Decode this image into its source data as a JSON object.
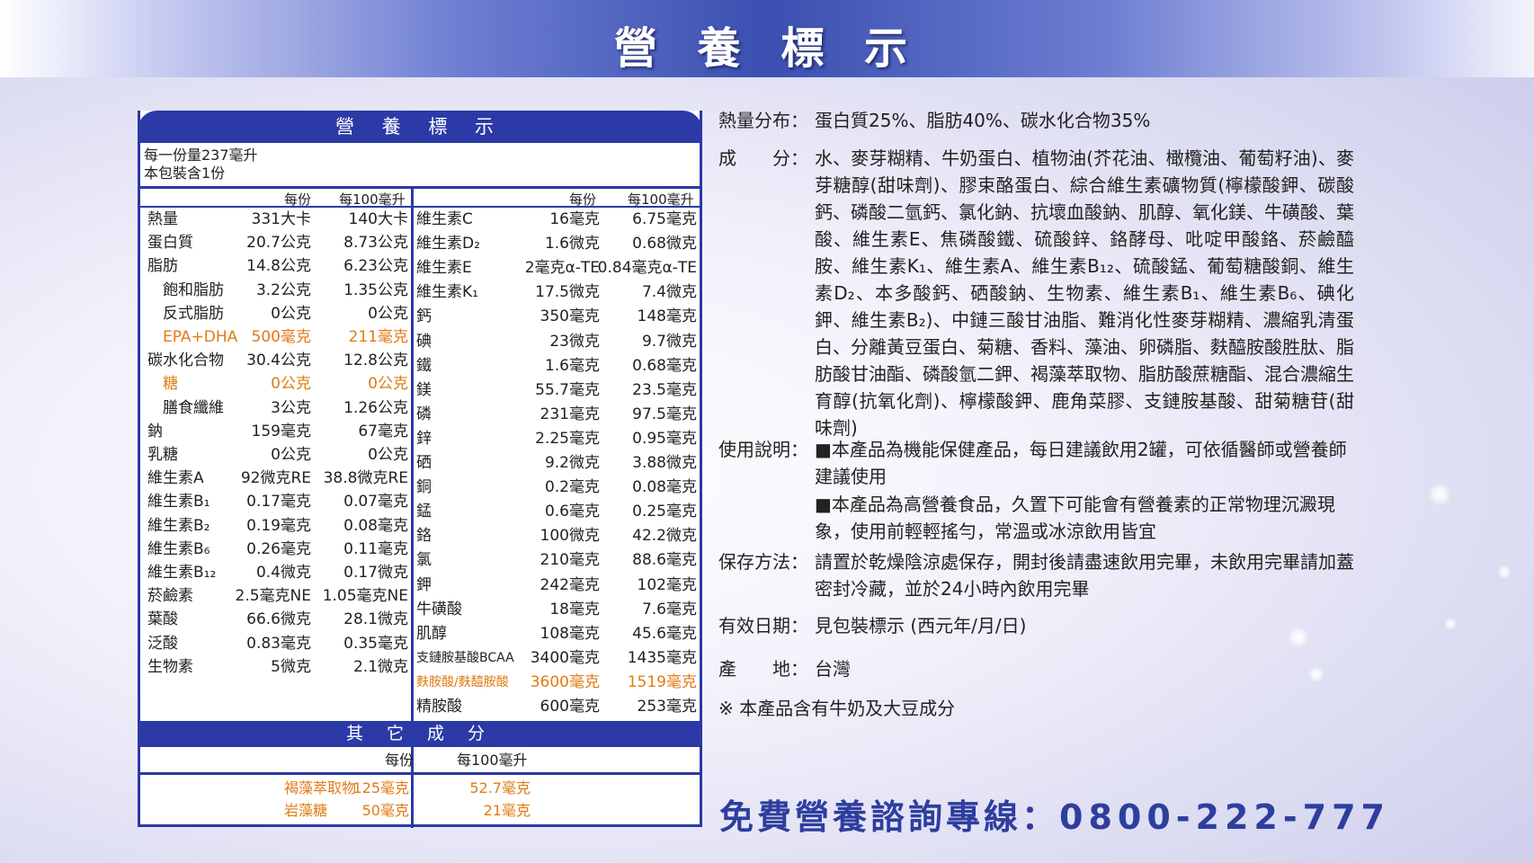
{
  "banner": {
    "title": "營 養 標 示"
  },
  "label": {
    "header": "營 養 標 示",
    "serving_size": "每一份量237毫升",
    "servings": "本包裝含1份",
    "col_per_serving": "每份",
    "col_per_100": "每100毫升",
    "left_rows": [
      {
        "name": "熱量",
        "a": "331大卡",
        "b": "140大卡"
      },
      {
        "name": "蛋白質",
        "a": "20.7公克",
        "b": "8.73公克"
      },
      {
        "name": "脂肪",
        "a": "14.8公克",
        "b": "6.23公克"
      },
      {
        "name": "飽和脂肪",
        "a": "3.2公克",
        "b": "1.35公克"
      },
      {
        "name": "反式脂肪",
        "a": "0公克",
        "b": "0公克"
      },
      {
        "name": "EPA+DHA",
        "a": "500毫克",
        "b": "211毫克"
      },
      {
        "name": "碳水化合物",
        "a": "30.4公克",
        "b": "12.8公克"
      },
      {
        "name": "糖",
        "a": "0公克",
        "b": "0公克"
      },
      {
        "name": "膳食纖維",
        "a": "3公克",
        "b": "1.26公克"
      },
      {
        "name": "鈉",
        "a": "159毫克",
        "b": "67毫克"
      },
      {
        "name": "乳糖",
        "a": "0公克",
        "b": "0公克"
      },
      {
        "name": "維生素A",
        "a": "92微克RE",
        "b": "38.8微克RE"
      },
      {
        "name": "維生素B₁",
        "a": "0.17毫克",
        "b": "0.07毫克"
      },
      {
        "name": "維生素B₂",
        "a": "0.19毫克",
        "b": "0.08毫克"
      },
      {
        "name": "維生素B₆",
        "a": "0.26毫克",
        "b": "0.11毫克"
      },
      {
        "name": "維生素B₁₂",
        "a": "0.4微克",
        "b": "0.17微克"
      },
      {
        "name": "菸鹼素",
        "a": "2.5毫克NE",
        "b": "1.05毫克NE"
      },
      {
        "name": "葉酸",
        "a": "66.6微克",
        "b": "28.1微克"
      },
      {
        "name": "泛酸",
        "a": "0.83毫克",
        "b": "0.35毫克"
      },
      {
        "name": "生物素",
        "a": "5微克",
        "b": "2.1微克"
      }
    ],
    "right_rows": [
      {
        "name": "維生素C",
        "a": "16毫克",
        "b": "6.75毫克"
      },
      {
        "name": "維生素D₂",
        "a": "1.6微克",
        "b": "0.68微克"
      },
      {
        "name": "維生素E",
        "a": "2毫克α-TE",
        "b": "0.84毫克α-TE"
      },
      {
        "name": "維生素K₁",
        "a": "17.5微克",
        "b": "7.4微克"
      },
      {
        "name": "鈣",
        "a": "350毫克",
        "b": "148毫克"
      },
      {
        "name": "碘",
        "a": "23微克",
        "b": "9.7微克"
      },
      {
        "name": "鐵",
        "a": "1.6毫克",
        "b": "0.68毫克"
      },
      {
        "name": "鎂",
        "a": "55.7毫克",
        "b": "23.5毫克"
      },
      {
        "name": "磷",
        "a": "231毫克",
        "b": "97.5毫克"
      },
      {
        "name": "鋅",
        "a": "2.25毫克",
        "b": "0.95毫克"
      },
      {
        "name": "硒",
        "a": "9.2微克",
        "b": "3.88微克"
      },
      {
        "name": "銅",
        "a": "0.2毫克",
        "b": "0.08毫克"
      },
      {
        "name": "錳",
        "a": "0.6毫克",
        "b": "0.25毫克"
      },
      {
        "name": "鉻",
        "a": "100微克",
        "b": "42.2微克"
      },
      {
        "name": "氯",
        "a": "210毫克",
        "b": "88.6毫克"
      },
      {
        "name": "鉀",
        "a": "242毫克",
        "b": "102毫克"
      },
      {
        "name": "牛磺酸",
        "a": "18毫克",
        "b": "7.6毫克"
      },
      {
        "name": "肌醇",
        "a": "108毫克",
        "b": "45.6毫克"
      },
      {
        "name": "支鏈胺基酸BCAA",
        "a": "3400毫克",
        "b": "1435毫克"
      },
      {
        "name": "麩胺酸/麩醯胺酸",
        "a": "3600毫克",
        "b": "1519毫克"
      },
      {
        "name": "精胺酸",
        "a": "600毫克",
        "b": "253毫克"
      }
    ],
    "other_header": "其 它 成 分",
    "other_col_a": "每份",
    "other_col_b": "每100毫升",
    "other_rows": [
      {
        "name": "褐藻萃取物",
        "a": "125毫克",
        "b": "52.7毫克"
      },
      {
        "name": "岩藻糖",
        "a": "50毫克",
        "b": "21毫克"
      }
    ]
  },
  "info": {
    "energy_label": "熱量分布：",
    "energy_text": "蛋白質25%、脂肪40%、碳水化合物35%",
    "ingredients_label": "成　　分：",
    "ingredients_text": "水、麥芽糊精、牛奶蛋白、植物油(芥花油、橄欖油、葡萄籽油)、麥芽糖醇(甜味劑)、膠束酪蛋白、綜合維生素礦物質(檸檬酸鉀、碳酸鈣、磷酸二氫鈣、氯化鈉、抗壞血酸鈉、肌醇、氧化鎂、牛磺酸、葉酸、維生素E、焦磷酸鐵、硫酸鋅、鉻酵母、吡啶甲酸鉻、菸鹼醯胺、維生素K₁、維生素A、維生素B₁₂、硫酸錳、葡萄糖酸銅、維生素D₂、本多酸鈣、硒酸鈉、生物素、維生素B₁、維生素B₆、碘化鉀、維生素B₂)、中鏈三酸甘油脂、難消化性麥芽糊精、濃縮乳清蛋白、分離黃豆蛋白、菊糖、香料、藻油、卵磷脂、麩醯胺酸胜肽、脂肪酸甘油酯、磷酸氫二鉀、褐藻萃取物、脂肪酸蔗糖酯、混合濃縮生育醇(抗氧化劑)、檸檬酸鉀、鹿角菜膠、支鏈胺基酸、甜菊糖苷(甜味劑)",
    "usage_label": "使用說明：",
    "usage_1": "■本產品為機能保健產品，每日建議飲用2罐，可依循醫師或營養師建議使用",
    "usage_2": "■本產品為高營養食品，久置下可能會有營養素的正常物理沉澱現象，使用前輕輕搖勻，常溫或冰涼飲用皆宜",
    "storage_label": "保存方法：",
    "storage_text": "請置於乾燥陰涼處保存，開封後請盡速飲用完畢，未飲用完畢請加蓋密封冷藏，並於24小時內飲用完畢",
    "expiry_label": "有效日期：",
    "expiry_text": "見包裝標示 (西元年/月/日)",
    "origin_label": "產　　地：",
    "origin_text": "台灣",
    "allergen_note": "※ 本產品含有牛奶及大豆成分"
  },
  "hotline": {
    "label": "免費營養諮詢專線：",
    "number": "0800-222-777"
  },
  "colors": {
    "brand_blue": "#2b3aa6",
    "highlight_orange": "#e07b16"
  }
}
